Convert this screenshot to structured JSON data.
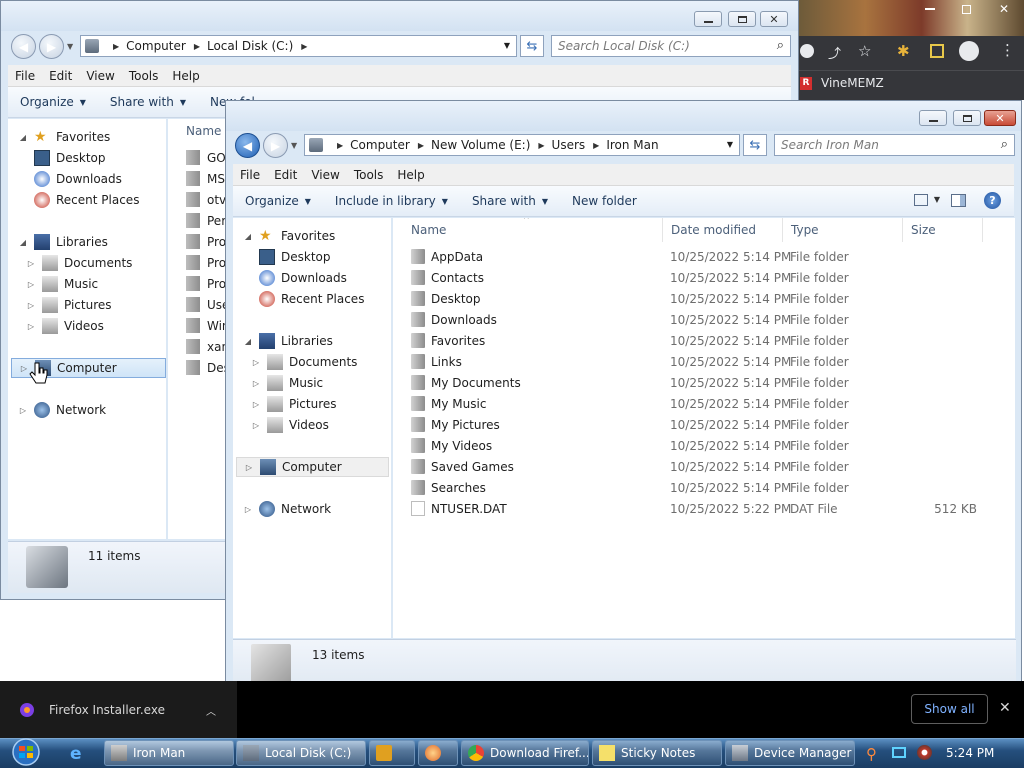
{
  "browser": {
    "bookmark": "VineMEMZ",
    "bookmark_badge": "R"
  },
  "back_window": {
    "breadcrumb": [
      "Computer",
      "Local Disk (C:)"
    ],
    "search_placeholder": "Search Local Disk (C:)",
    "menu": [
      "File",
      "Edit",
      "View",
      "Tools",
      "Help"
    ],
    "commands": {
      "organize": "Organize",
      "share": "Share with",
      "new_folder_partial": "New fol"
    },
    "column_name": "Name",
    "nav": {
      "favorites": "Favorites",
      "desktop": "Desktop",
      "downloads": "Downloads",
      "recent": "Recent Places",
      "libraries": "Libraries",
      "documents": "Documents",
      "music": "Music",
      "pictures": "Pictures",
      "videos": "Videos",
      "computer": "Computer",
      "network": "Network"
    },
    "files_partial": [
      "GO",
      "MS",
      "otv",
      "Per",
      "Pro",
      "Pro",
      "Pro",
      "Use",
      "Win",
      "xan",
      "Des"
    ],
    "status": "11 items"
  },
  "front_window": {
    "breadcrumb": [
      "Computer",
      "New Volume (E:)",
      "Users",
      "Iron Man"
    ],
    "search_placeholder": "Search Iron Man",
    "menu": [
      "File",
      "Edit",
      "View",
      "Tools",
      "Help"
    ],
    "commands": {
      "organize": "Organize",
      "include": "Include in library",
      "share": "Share with",
      "new_folder": "New folder"
    },
    "columns": {
      "name": "Name",
      "date": "Date modified",
      "type": "Type",
      "size": "Size"
    },
    "nav": {
      "favorites": "Favorites",
      "desktop": "Desktop",
      "downloads": "Downloads",
      "recent": "Recent Places",
      "libraries": "Libraries",
      "documents": "Documents",
      "music": "Music",
      "pictures": "Pictures",
      "videos": "Videos",
      "computer": "Computer",
      "network": "Network"
    },
    "files": [
      {
        "name": "AppData",
        "date": "10/25/2022 5:14 PM",
        "type": "File folder",
        "size": ""
      },
      {
        "name": "Contacts",
        "date": "10/25/2022 5:14 PM",
        "type": "File folder",
        "size": ""
      },
      {
        "name": "Desktop",
        "date": "10/25/2022 5:14 PM",
        "type": "File folder",
        "size": ""
      },
      {
        "name": "Downloads",
        "date": "10/25/2022 5:14 PM",
        "type": "File folder",
        "size": ""
      },
      {
        "name": "Favorites",
        "date": "10/25/2022 5:14 PM",
        "type": "File folder",
        "size": ""
      },
      {
        "name": "Links",
        "date": "10/25/2022 5:14 PM",
        "type": "File folder",
        "size": ""
      },
      {
        "name": "My Documents",
        "date": "10/25/2022 5:14 PM",
        "type": "File folder",
        "size": ""
      },
      {
        "name": "My Music",
        "date": "10/25/2022 5:14 PM",
        "type": "File folder",
        "size": ""
      },
      {
        "name": "My Pictures",
        "date": "10/25/2022 5:14 PM",
        "type": "File folder",
        "size": ""
      },
      {
        "name": "My Videos",
        "date": "10/25/2022 5:14 PM",
        "type": "File folder",
        "size": ""
      },
      {
        "name": "Saved Games",
        "date": "10/25/2022 5:14 PM",
        "type": "File folder",
        "size": ""
      },
      {
        "name": "Searches",
        "date": "10/25/2022 5:14 PM",
        "type": "File folder",
        "size": ""
      },
      {
        "name": "NTUSER.DAT",
        "date": "10/25/2022 5:22 PM",
        "type": "DAT File",
        "size": "512 KB"
      }
    ],
    "status": "13 items"
  },
  "download_bar": {
    "file": "Firefox Installer.exe",
    "show_all": "Show all"
  },
  "taskbar": {
    "buttons": [
      "Iron Man",
      "Local Disk (C:)",
      "Download Firef...",
      "Sticky Notes",
      "Device Manager"
    ],
    "clock": "5:24 PM"
  },
  "colors": {
    "explorer_frame": "#dbe8f5",
    "taskbar": "#254f7d",
    "accent_blue": "#1e5fb4"
  }
}
